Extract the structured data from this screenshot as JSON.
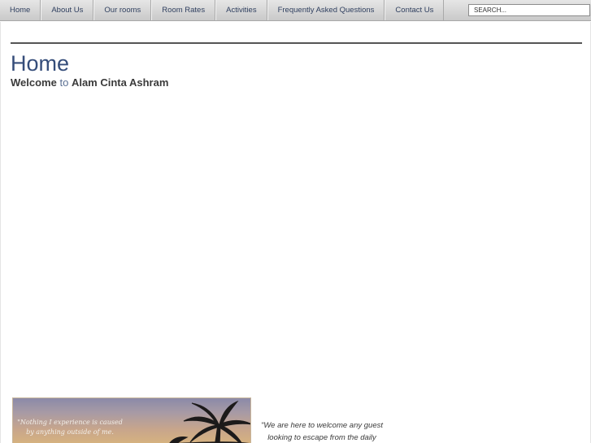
{
  "nav": {
    "items": [
      {
        "label": "Home"
      },
      {
        "label": "About Us"
      },
      {
        "label": "Our rooms"
      },
      {
        "label": "Room Rates"
      },
      {
        "label": "Activities"
      },
      {
        "label": "Frequently Asked Questions"
      },
      {
        "label": "Contact Us"
      }
    ]
  },
  "search": {
    "placeholder": "SEARCH..."
  },
  "main": {
    "title": "Home",
    "welcome": {
      "part1": "Welcome",
      "part2": "to",
      "part3": "Alam Cinta Ashram"
    }
  },
  "photo": {
    "caption_line1": "\"Nothing I experience is caused",
    "caption_line2": "by anything outside of me."
  },
  "quote": {
    "line1": "\"We are here to welcome any guest",
    "line2": "looking to escape from the daily"
  }
}
